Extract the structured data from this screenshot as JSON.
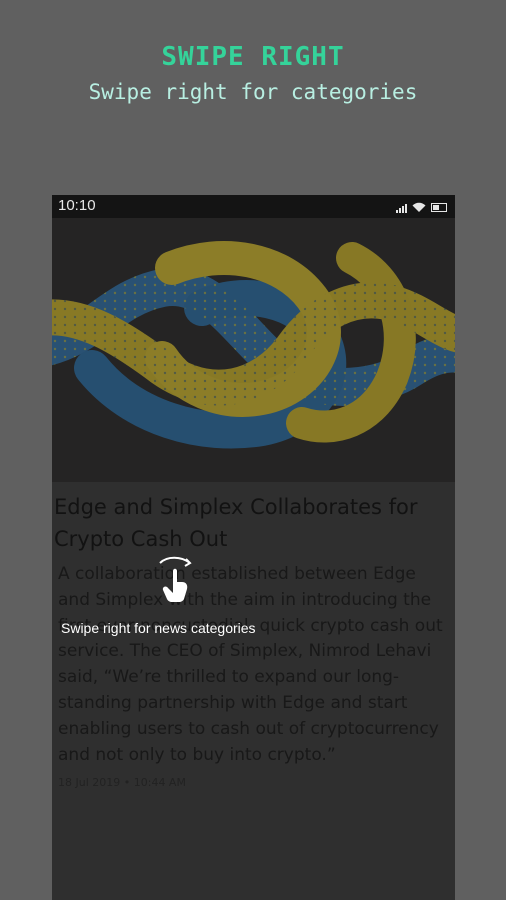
{
  "colors": {
    "background": "#606060",
    "promo_title": "#35d39a",
    "promo_subtitle": "#b8efe2",
    "overlay_text": "#ffffff"
  },
  "promo": {
    "title": "SWIPE RIGHT",
    "subtitle": "Swipe right for categories"
  },
  "status_bar": {
    "time": "10:10",
    "icons": [
      "signal-icon",
      "wifi-icon",
      "battery-icon"
    ]
  },
  "article": {
    "image": "rope-knot-photo",
    "title": "Edge and Simplex Collaborates for Crypto Cash Out",
    "body": "A collaboration established between Edge and Simplex with the aim in introducing the first ever noncustodial, quick crypto cash out service. The CEO of Simplex, Nimrod Lehavi said, “We’re thrilled to expand our long-standing partnership with Edge and start enabling users to cash out of cryptocurrency and not only to buy into crypto.”",
    "meta": "18 Jul 2019 • 10:44 AM"
  },
  "overlay": {
    "hint_icon": "swipe-hand-icon",
    "hint_text": "Swipe right for news categories"
  }
}
